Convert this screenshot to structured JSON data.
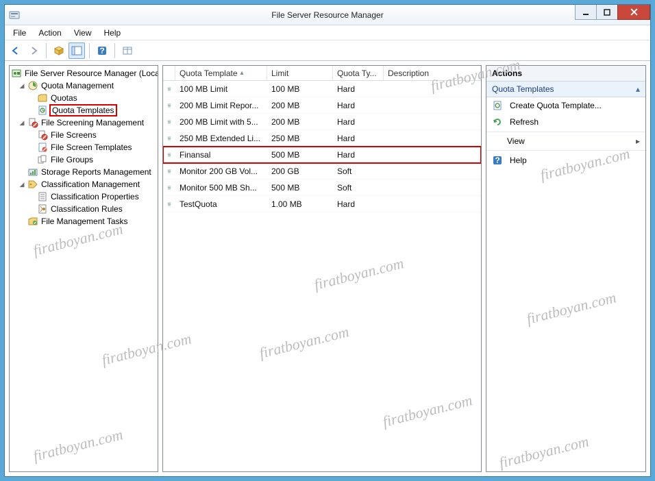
{
  "window": {
    "title": "File Server Resource Manager"
  },
  "menu": {
    "file": "File",
    "action": "Action",
    "view": "View",
    "help": "Help"
  },
  "tree": {
    "root": "File Server Resource Manager (Local)",
    "quota_mgmt": "Quota Management",
    "quotas": "Quotas",
    "quota_templates": "Quota Templates",
    "fs_mgmt": "File Screening Management",
    "file_screens": "File Screens",
    "file_screen_templates": "File Screen Templates",
    "file_groups": "File Groups",
    "storage_reports": "Storage Reports Management",
    "class_mgmt": "Classification Management",
    "class_props": "Classification Properties",
    "class_rules": "Classification Rules",
    "file_mgmt_tasks": "File Management Tasks"
  },
  "columns": {
    "quota_template": "Quota Template",
    "limit": "Limit",
    "quota_type": "Quota Ty...",
    "description": "Description"
  },
  "rows": [
    {
      "qt": "100 MB Limit",
      "limit": "100 MB",
      "type": "Hard",
      "hl": false
    },
    {
      "qt": "200 MB Limit Repor...",
      "limit": "200 MB",
      "type": "Hard",
      "hl": false
    },
    {
      "qt": "200 MB Limit with 5...",
      "limit": "200 MB",
      "type": "Hard",
      "hl": false
    },
    {
      "qt": "250 MB Extended Li...",
      "limit": "250 MB",
      "type": "Hard",
      "hl": false
    },
    {
      "qt": "Finansal",
      "limit": "500 MB",
      "type": "Hard",
      "hl": true
    },
    {
      "qt": "Monitor 200 GB Vol...",
      "limit": "200 GB",
      "type": "Soft",
      "hl": false
    },
    {
      "qt": "Monitor 500 MB Sh...",
      "limit": "500 MB",
      "type": "Soft",
      "hl": false
    },
    {
      "qt": "TestQuota",
      "limit": "1.00 MB",
      "type": "Hard",
      "hl": false
    }
  ],
  "actions": {
    "header": "Actions",
    "group": "Quota Templates",
    "create": "Create Quota Template...",
    "refresh": "Refresh",
    "view": "View",
    "help": "Help"
  },
  "watermark": "firatboyan.com"
}
